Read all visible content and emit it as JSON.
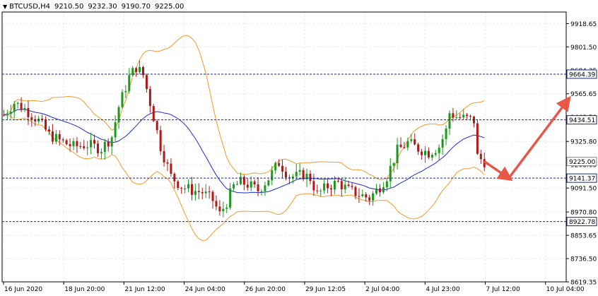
{
  "header": {
    "symbol": "BTCUSD,H4",
    "open": "9210.50",
    "high": "9232.30",
    "low": "9190.70",
    "close": "9225.00"
  },
  "colors": {
    "background": "#ffffff",
    "grid": "#e6e6e6",
    "frame": "#000000",
    "bull_candle": "#1a9a1a",
    "bear_candle": "#b01818",
    "bollinger": "#f39a2b",
    "moving_average": "#1f2bd6",
    "level_line": "#1a2a7a",
    "arrow": "#e8584a",
    "current_price_label_bg": "#ffffff"
  },
  "chart_data": {
    "type": "candlestick",
    "symbol": "BTCUSD",
    "timeframe": "H4",
    "ylim": [
      8619.35,
      9977.0
    ],
    "y_ticks": [
      "9918.65",
      "9801.50",
      "9684.35",
      "9565.65",
      "9448.50",
      "9325.80",
      "9208.65",
      "9091.50",
      "8970.80",
      "8853.65",
      "8736.50",
      "8619.35"
    ],
    "x_ticks": [
      "16 Jun 2020",
      "18 Jun 20:00",
      "21 Jun 12:00",
      "24 Jun 04:00",
      "26 Jun 20:00",
      "29 Jun 12:05",
      "2 Jul 04:00",
      "4 Jul 23:00",
      "7 Jul 12:00",
      "10 Jul 04:00"
    ],
    "levels": [
      {
        "value": 9664.39,
        "label": "9664.39"
      },
      {
        "value": 9434.51,
        "label": "9434.51"
      },
      {
        "value": 9141.37,
        "label": "9141.37"
      },
      {
        "value": 8922.78,
        "label": "8922.78"
      }
    ],
    "current_price": {
      "value": 9225.0,
      "label": "9225.00"
    },
    "anchors": [
      [
        0,
        9460
      ],
      [
        3,
        9520
      ],
      [
        6,
        9490
      ],
      [
        10,
        9430
      ],
      [
        13,
        9360
      ],
      [
        16,
        9330
      ],
      [
        20,
        9300
      ],
      [
        24,
        9310
      ],
      [
        28,
        9290
      ],
      [
        31,
        9350
      ],
      [
        33,
        9500
      ],
      [
        36,
        9650
      ],
      [
        38,
        9700
      ],
      [
        40,
        9660
      ],
      [
        43,
        9450
      ],
      [
        45,
        9300
      ],
      [
        48,
        9150
      ],
      [
        51,
        9100
      ],
      [
        54,
        9080
      ],
      [
        57,
        9070
      ],
      [
        60,
        9030
      ],
      [
        62,
        8960
      ],
      [
        64,
        9020
      ],
      [
        66,
        9100
      ],
      [
        68,
        9120
      ],
      [
        70,
        9110
      ],
      [
        73,
        9080
      ],
      [
        76,
        9140
      ],
      [
        79,
        9220
      ],
      [
        82,
        9150
      ],
      [
        84,
        9150
      ],
      [
        86,
        9160
      ],
      [
        88,
        9140
      ],
      [
        90,
        9060
      ],
      [
        93,
        9100
      ],
      [
        96,
        9120
      ],
      [
        99,
        9080
      ],
      [
        102,
        9060
      ],
      [
        105,
        9040
      ],
      [
        108,
        9100
      ],
      [
        110,
        9150
      ],
      [
        113,
        9280
      ],
      [
        116,
        9320
      ],
      [
        119,
        9290
      ],
      [
        122,
        9270
      ],
      [
        125,
        9300
      ],
      [
        127,
        9380
      ],
      [
        128,
        9470
      ],
      [
        130,
        9450
      ],
      [
        133,
        9440
      ],
      [
        135,
        9430
      ],
      [
        136,
        9250
      ],
      [
        138,
        9225
      ]
    ],
    "projection_arrows": [
      {
        "from": [
          138,
          9225
        ],
        "to": [
          145,
          9141
        ]
      },
      {
        "from": [
          145,
          9141
        ],
        "to": [
          162,
          9535
        ]
      }
    ]
  }
}
